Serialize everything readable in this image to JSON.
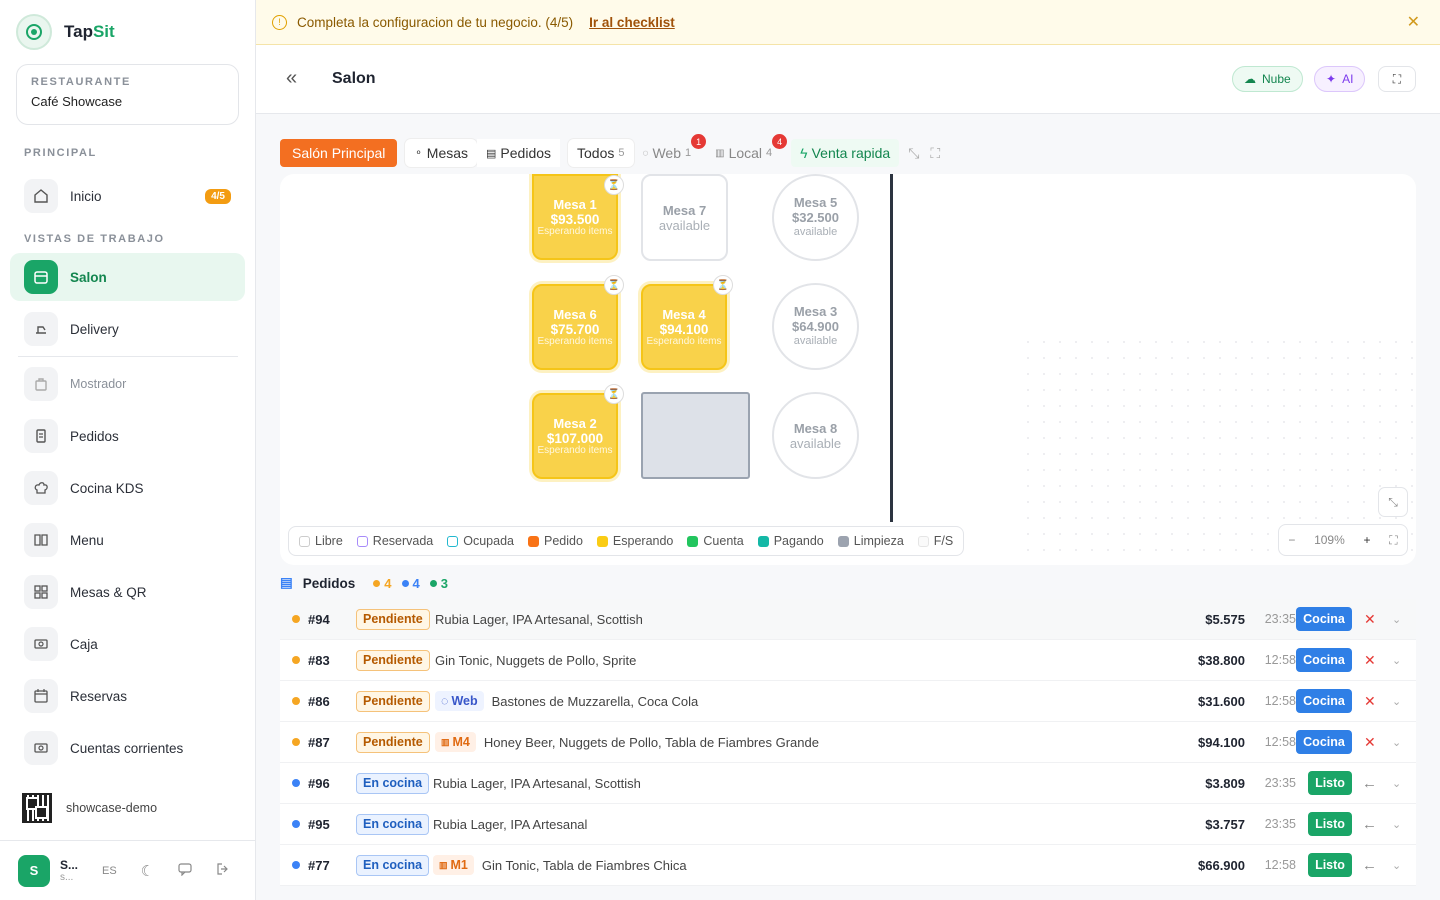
{
  "brand": {
    "name_a": "Tap",
    "name_b": "Sit"
  },
  "restaurant": {
    "caption": "RESTAURANTE",
    "name": "Café Showcase"
  },
  "sections": {
    "principal": "PRINCIPAL",
    "work": "VISTAS DE TRABAJO"
  },
  "nav": {
    "inicio": {
      "label": "Inicio",
      "badge": "4/5"
    },
    "salon": {
      "label": "Salon"
    },
    "delivery": {
      "label": "Delivery"
    },
    "mostrador": {
      "label": "Mostrador"
    },
    "pedidos": {
      "label": "Pedidos"
    },
    "cocina": {
      "label": "Cocina KDS"
    },
    "menu": {
      "label": "Menu"
    },
    "mesas": {
      "label": "Mesas & QR"
    },
    "caja": {
      "label": "Caja"
    },
    "reservas": {
      "label": "Reservas"
    },
    "cuentas": {
      "label": "Cuentas corrientes"
    }
  },
  "qr": {
    "label": "showcase-demo"
  },
  "user": {
    "initial": "S",
    "name": "S...",
    "sub": "s...",
    "lang": "ES"
  },
  "banner": {
    "text": "Completa la configuracion de tu negocio. (4/5)",
    "link": "Ir al checklist",
    "close": "✕"
  },
  "header": {
    "back": "«",
    "title": "Salon",
    "cloud": "Nube",
    "ai": "AI"
  },
  "toolbar": {
    "room": "Salón Principal",
    "mesas": "Mesas",
    "pedidos": "Pedidos",
    "todos": "Todos",
    "todos_count": "5",
    "web": "Web",
    "web_count": "1",
    "web_badge": "1",
    "local": "Local",
    "local_count": "4",
    "local_badge": "4",
    "quick": "Venta rapida"
  },
  "tables": {
    "mesa1": {
      "name": "Mesa 1",
      "amount": "$93.500",
      "status": "Esperando items"
    },
    "mesa7": {
      "name": "Mesa 7",
      "status": "available"
    },
    "mesa5": {
      "name": "Mesa 5",
      "amount": "$32.500",
      "status": "available"
    },
    "mesa6": {
      "name": "Mesa 6",
      "amount": "$75.700",
      "status": "Esperando items"
    },
    "mesa4": {
      "name": "Mesa 4",
      "amount": "$94.100",
      "status": "Esperando items"
    },
    "mesa3": {
      "name": "Mesa 3",
      "amount": "$64.900",
      "status": "available"
    },
    "mesa2": {
      "name": "Mesa 2",
      "amount": "$107.000",
      "status": "Esperando items"
    },
    "mesa8": {
      "name": "Mesa 8",
      "status": "available"
    }
  },
  "legend": [
    {
      "label": "Libre",
      "color": "#ffffff"
    },
    {
      "label": "Reservada",
      "color": "#a78bfa"
    },
    {
      "label": "Ocupada",
      "color": "#22b8cf"
    },
    {
      "label": "Pedido",
      "color": "#f97316"
    },
    {
      "label": "Esperando",
      "color": "#facc15"
    },
    {
      "label": "Cuenta",
      "color": "#22c55e"
    },
    {
      "label": "Pagando",
      "color": "#14b8a6"
    },
    {
      "label": "Limpieza",
      "color": "#9ca3af"
    },
    {
      "label": "F/S",
      "color": "#ffffff"
    }
  ],
  "zoom": {
    "minus": "−",
    "value": "109%",
    "plus": "+"
  },
  "orders": {
    "title": "Pedidos",
    "counts": [
      {
        "value": "4",
        "color": "#f5a623"
      },
      {
        "value": "4",
        "color": "#3b82f6"
      },
      {
        "value": "3",
        "color": "#1aa567"
      }
    ],
    "rows": [
      {
        "num": "#94",
        "status": "Pendiente",
        "items": "Rubia Lager, IPA Artesanal, Scottish",
        "amount": "$5.575",
        "time": "23:35",
        "action": "Cocina"
      },
      {
        "num": "#83",
        "status": "Pendiente",
        "items": "Gin Tonic, Nuggets de Pollo, Sprite",
        "amount": "$38.800",
        "time": "12:58",
        "action": "Cocina"
      },
      {
        "num": "#86",
        "status": "Pendiente",
        "tag": "Web",
        "items": "Bastones de Muzzarella, Coca Cola",
        "amount": "$31.600",
        "time": "12:58",
        "action": "Cocina"
      },
      {
        "num": "#87",
        "status": "Pendiente",
        "tag": "M4",
        "items": "Honey Beer, Nuggets de Pollo, Tabla de Fiambres Grande",
        "amount": "$94.100",
        "time": "12:58",
        "action": "Cocina"
      },
      {
        "num": "#96",
        "status": "En cocina",
        "items": "Rubia Lager, IPA Artesanal, Scottish",
        "amount": "$3.809",
        "time": "23:35",
        "action": "Listo"
      },
      {
        "num": "#95",
        "status": "En cocina",
        "items": "Rubia Lager, IPA Artesanal",
        "amount": "$3.757",
        "time": "23:35",
        "action": "Listo"
      },
      {
        "num": "#77",
        "status": "En cocina",
        "tag": "M1",
        "items": "Gin Tonic, Tabla de Fiambres Chica",
        "amount": "$66.900",
        "time": "12:58",
        "action": "Listo"
      }
    ]
  },
  "colors": {
    "accent": "#1aa567",
    "pending": "#f5a623",
    "kitchen": "#3b82f6",
    "waiting": "#f9d24a"
  }
}
